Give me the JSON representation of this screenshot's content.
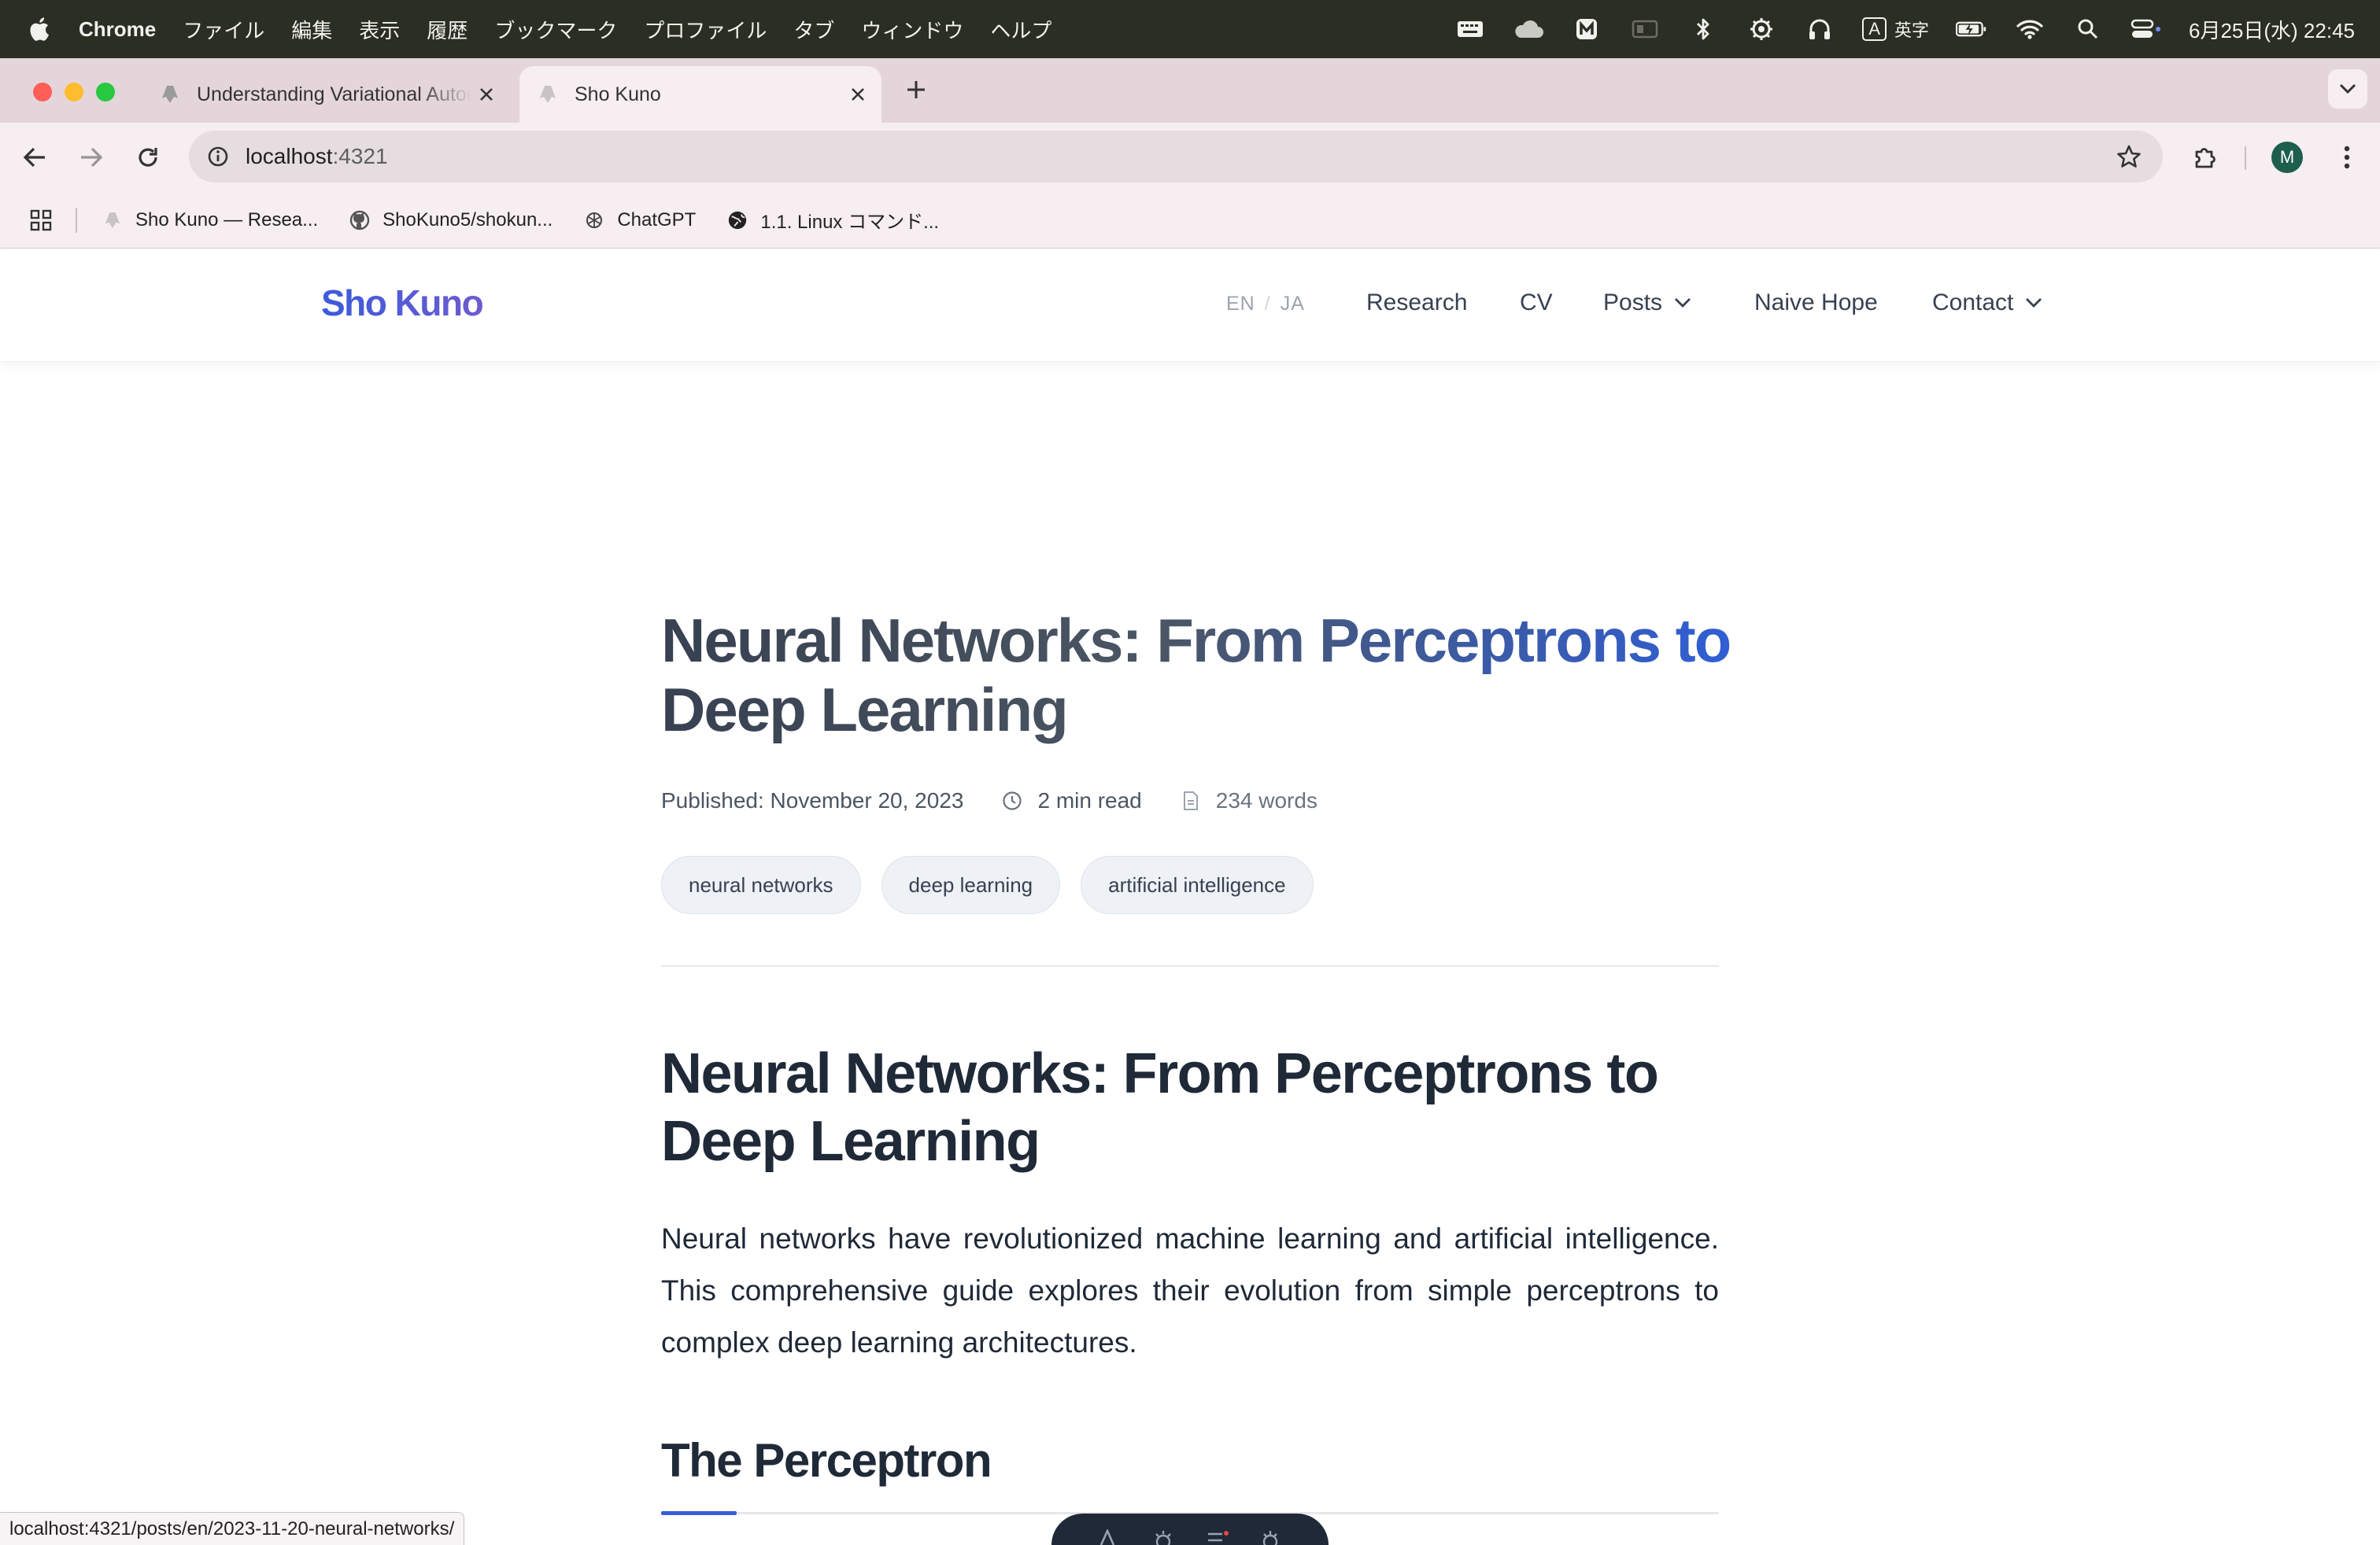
{
  "menubar": {
    "app_name": "Chrome",
    "menus": [
      "ファイル",
      "編集",
      "表示",
      "履歴",
      "ブックマーク",
      "プロファイル",
      "タブ",
      "ウィンドウ",
      "ヘルプ"
    ],
    "ime_label": "A",
    "ime_text": "英字",
    "clock": "6月25日(水) 22:45"
  },
  "browser": {
    "tabs": [
      {
        "title": "Understanding Variational Autoencoders",
        "active": false
      },
      {
        "title": "Sho Kuno",
        "active": true
      }
    ],
    "url_host": "localhost",
    "url_port": ":4321",
    "avatar_initial": "M",
    "bookmarks": [
      {
        "label": "Sho Kuno — Resea...",
        "icon": "site-icon"
      },
      {
        "label": "ShoKuno5/shokun...",
        "icon": "github-icon"
      },
      {
        "label": "ChatGPT",
        "icon": "chatgpt-icon"
      },
      {
        "label": "1.1. Linux コマンド...",
        "icon": "globe-icon"
      }
    ],
    "status_url": "localhost:4321/posts/en/2023-11-20-neural-networks/"
  },
  "site": {
    "logo": "Sho Kuno",
    "lang_en": "EN",
    "lang_ja": "JA",
    "lang_sep": "/",
    "nav": [
      {
        "label": "Research",
        "dropdown": false
      },
      {
        "label": "CV",
        "dropdown": false
      },
      {
        "label": "Posts",
        "dropdown": true
      },
      {
        "label": "Naive Hope",
        "dropdown": false
      },
      {
        "label": "Contact",
        "dropdown": true
      }
    ]
  },
  "article": {
    "title": "Neural Networks: From Perceptrons to Deep Learning",
    "published": "Published: November 20, 2023",
    "read_time": "2 min read",
    "word_count": "234 words",
    "tags": [
      "neural networks",
      "deep learning",
      "artificial intelligence"
    ],
    "heading": "Neural Networks: From Perceptrons to Deep Learning",
    "intro": "Neural networks have revolutionized machine learning and artificial intelligence. This comprehensive guide explores their evolution from simple perceptrons to complex deep learning architectures.",
    "section_heading": "The Perceptron"
  },
  "colors": {
    "brand": "#3b5bdb",
    "menubar_bg": "#2b2e23",
    "tabstrip_bg": "#e4d5db"
  }
}
